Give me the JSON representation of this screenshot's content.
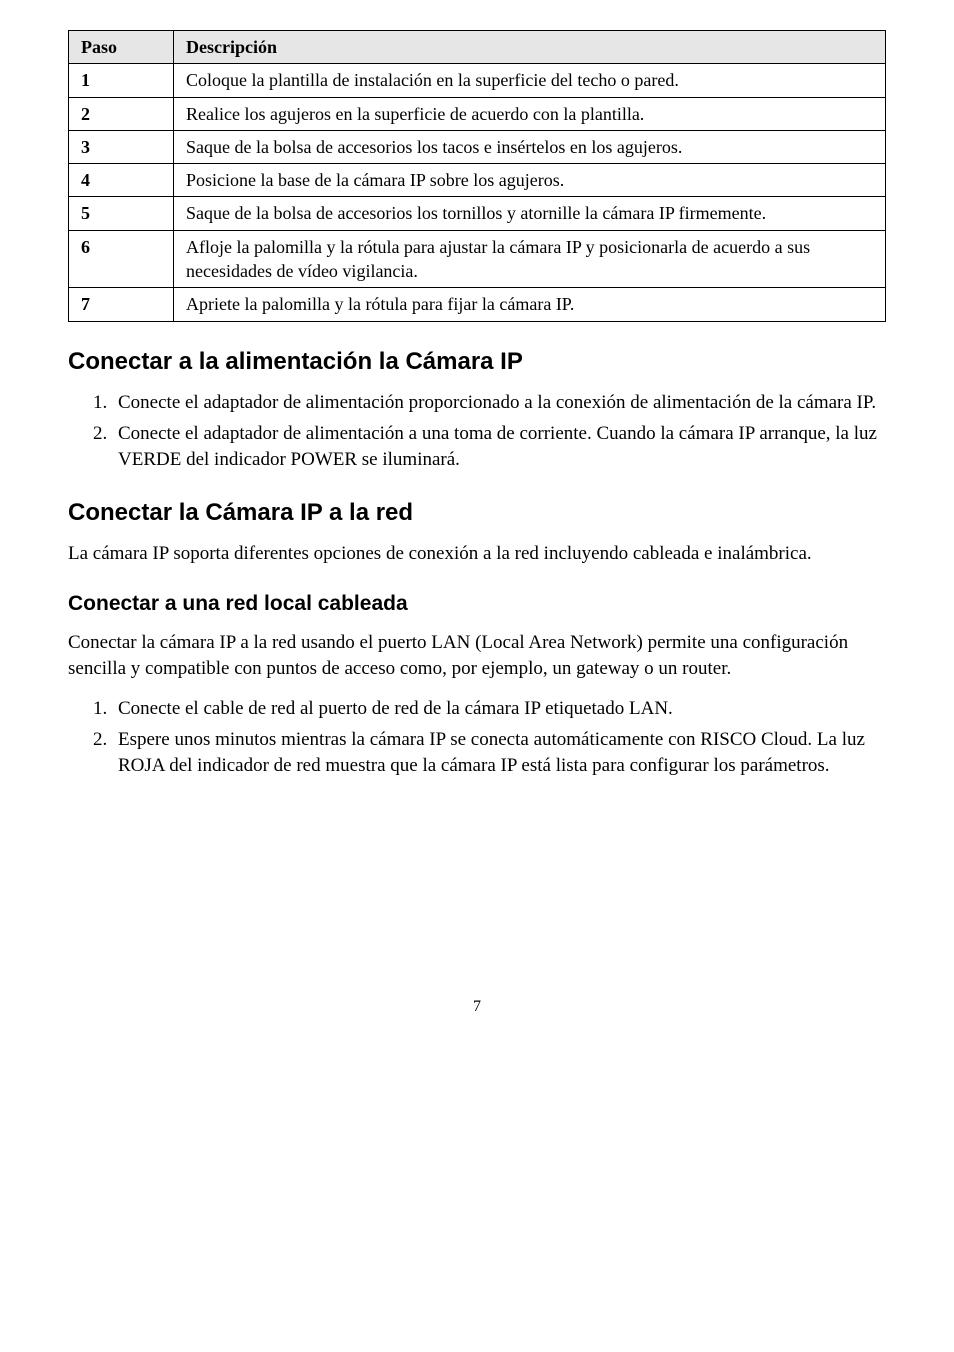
{
  "table": {
    "headers": {
      "paso": "Paso",
      "descripcion": "Descripción"
    },
    "rows": [
      {
        "num": "1",
        "desc": "Coloque la plantilla de instalación en la superficie del techo o pared."
      },
      {
        "num": "2",
        "desc": "Realice los agujeros en la superficie de acuerdo con la plantilla."
      },
      {
        "num": "3",
        "desc": "Saque de la bolsa de accesorios los tacos e insértelos en los agujeros."
      },
      {
        "num": "4",
        "desc": "Posicione la base de la cámara IP sobre los agujeros."
      },
      {
        "num": "5",
        "desc": "Saque de la bolsa de accesorios los tornillos y atornille la cámara IP firmemente."
      },
      {
        "num": "6",
        "desc": "Afloje la palomilla y la rótula para ajustar la cámara IP y posicionarla de acuerdo a sus necesidades de vídeo vigilancia."
      },
      {
        "num": "7",
        "desc": "Apriete la palomilla y la rótula para fijar la cámara IP."
      }
    ]
  },
  "section1": {
    "title": "Conectar a la alimentación la Cámara IP",
    "items": [
      "Conecte el adaptador de alimentación proporcionado a la conexión de alimentación de la cámara IP.",
      "Conecte el adaptador de alimentación a una toma de corriente. Cuando la cámara IP arranque, la luz VERDE del indicador POWER se iluminará."
    ]
  },
  "section2": {
    "title": "Conectar la Cámara IP a la red",
    "intro": "La cámara IP soporta diferentes opciones de conexión a la red incluyendo cableada e inalámbrica.",
    "subsection": {
      "title": "Conectar a una red local cableada",
      "intro": "Conectar la cámara IP a la red usando el puerto LAN (Local Area Network) permite una configuración sencilla y compatible con puntos de acceso como, por ejemplo, un gateway o un router.",
      "items": [
        "Conecte el cable de red al puerto de red de la cámara IP etiquetado LAN.",
        "Espere unos minutos mientras la cámara IP se conecta automáticamente con RISCO Cloud. La luz ROJA del indicador de red muestra que la cámara IP está lista para configurar los parámetros."
      ]
    }
  },
  "page_number": "7"
}
